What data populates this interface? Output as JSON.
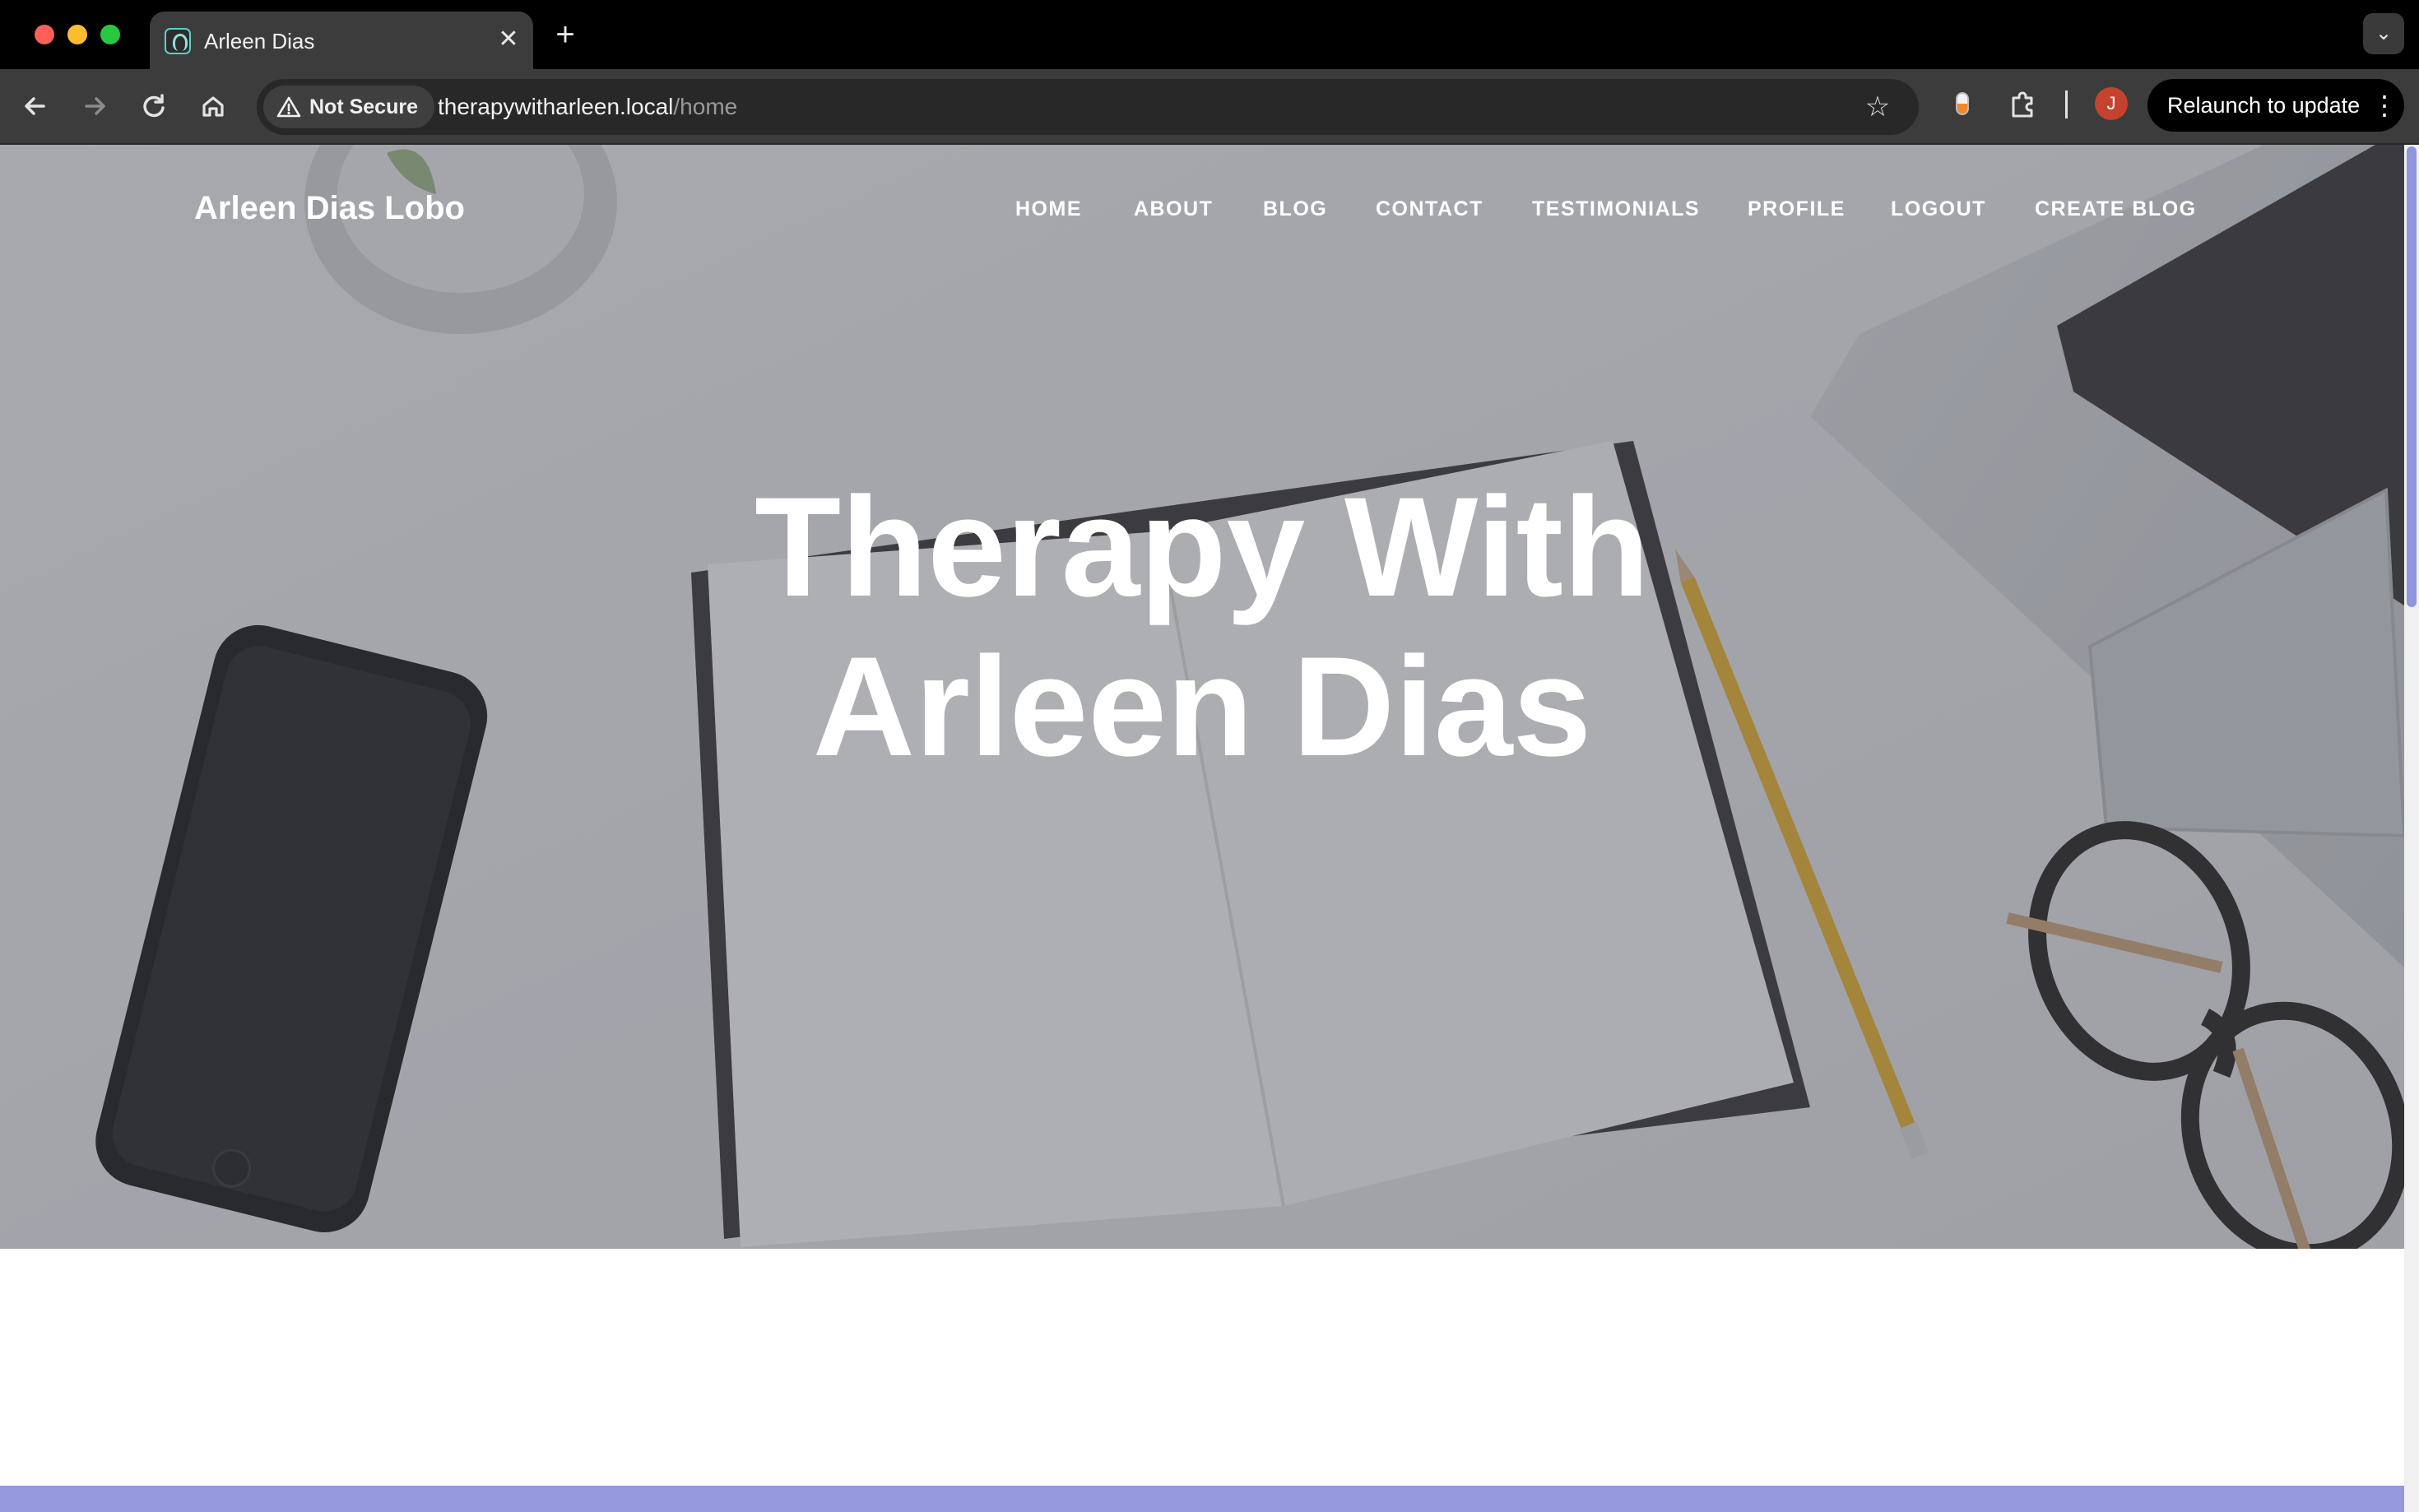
{
  "browser": {
    "tab": {
      "title": "Arleen Dias"
    },
    "security": {
      "label": "Not Secure"
    },
    "address": {
      "host": "therapywitharleen.local",
      "path": "/home"
    },
    "profile": {
      "initial": "J"
    },
    "relaunch": {
      "label": "Relaunch to update"
    }
  },
  "site": {
    "brand": "Arleen Dias Lobo",
    "nav": [
      "HOME",
      "ABOUT",
      "BLOG",
      "CONTACT",
      "TESTIMONIALS",
      "PROFILE",
      "LOGOUT",
      "CREATE BLOG"
    ],
    "hero": {
      "line1": "Therapy With",
      "line2": "Arleen Dias"
    }
  },
  "colors": {
    "accent": "#9399dc",
    "tab_active": "#3c3c3c",
    "avatar": "#c5432e"
  },
  "icons": {
    "back": "arrow-left-icon",
    "forward": "arrow-right-icon",
    "reload": "reload-icon",
    "home": "home-icon",
    "warning": "warning-icon",
    "bookmark": "star-icon",
    "extensions": "puzzle-icon",
    "menu": "kebab-icon"
  }
}
